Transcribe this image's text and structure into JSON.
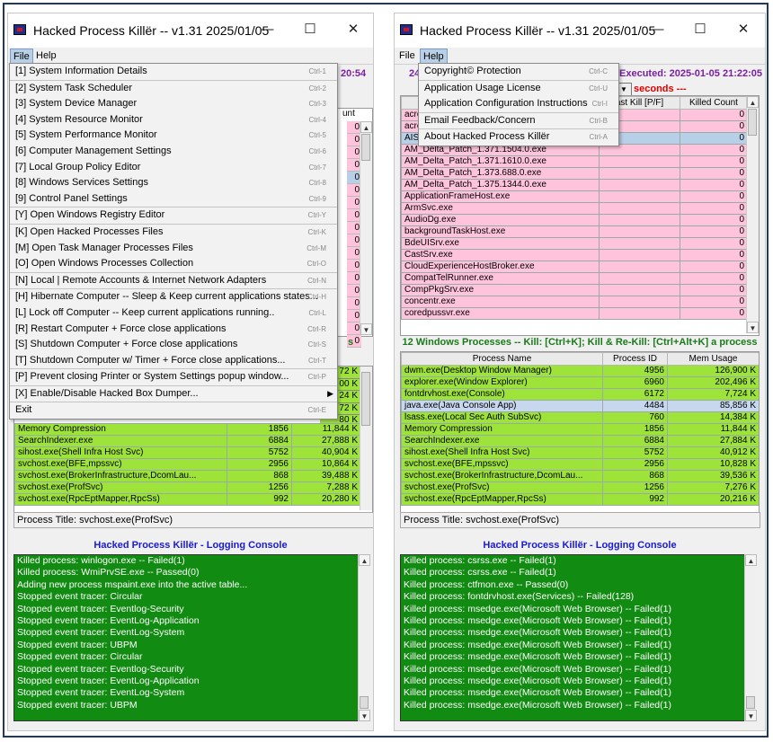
{
  "left": {
    "title": "Hacked Process Killër -- v1.31 2025/01/05",
    "menu_file": "File",
    "menu_help": "Help",
    "subtitle_visible": "20:54",
    "top_columns": [
      "unt"
    ],
    "top_values": [
      "0",
      "0",
      "0",
      "0",
      "0",
      "0",
      "0",
      "0",
      "0",
      "0",
      "0",
      "0",
      "0",
      "0",
      "0",
      "0",
      "0",
      "0"
    ],
    "mid_visible_title": "s",
    "mid_values": [
      "72 K",
      "00 K",
      "24 K",
      "72 K",
      "80 K"
    ],
    "rows": [
      {
        "name": "Memory Compression",
        "pid": "1856",
        "mem": "11,844 K"
      },
      {
        "name": "SearchIndexer.exe",
        "pid": "6884",
        "mem": "27,888 K"
      },
      {
        "name": "sihost.exe(Shell Infra Host Svc)",
        "pid": "5752",
        "mem": "40,904 K"
      },
      {
        "name": "svchost.exe(BFE,mpssvc)",
        "pid": "2956",
        "mem": "10,864 K"
      },
      {
        "name": "svchost.exe(BrokerInfrastructure,DcomLau...",
        "pid": "868",
        "mem": "39,488 K"
      },
      {
        "name": "svchost.exe(ProfSvc)",
        "pid": "1256",
        "mem": "7,288 K"
      },
      {
        "name": "svchost.exe(RpcEptMapper,RpcSs)",
        "pid": "992",
        "mem": "20,280 K"
      }
    ],
    "process_title": "Process Title: svchost.exe(ProfSvc)",
    "console_title": "Hacked Process Killër - Logging Console",
    "console_lines": [
      "Killed process: winlogon.exe -- Failed(1)",
      "Killed process: WmiPrvSE.exe -- Passed(0)",
      "Adding new process mspaint.exe into the active table...",
      "Stopped event tracer: Circular",
      "Stopped event tracer: Eventlog-Security",
      "Stopped event tracer: EventLog-Application",
      "Stopped event tracer: EventLog-System",
      "Stopped event tracer: UBPM",
      "Stopped event tracer: Circular",
      "Stopped event tracer: Eventlog-Security",
      "Stopped event tracer: EventLog-Application",
      "Stopped event tracer: EventLog-System",
      "Stopped event tracer: UBPM"
    ],
    "file_menu": [
      {
        "label": "[1] System Information Details",
        "shortcut": "Ctrl-1",
        "sep": false
      },
      {
        "label": "[2] System Task Scheduler",
        "shortcut": "Ctrl-2",
        "sep": true
      },
      {
        "label": "[3] System Device Manager",
        "shortcut": "Ctrl-3",
        "sep": false
      },
      {
        "label": "[4] System Resource Monitor",
        "shortcut": "Ctrl-4",
        "sep": false
      },
      {
        "label": "[5] System Performance Monitor",
        "shortcut": "Ctrl-5",
        "sep": false
      },
      {
        "label": "[6] Computer Management Settings",
        "shortcut": "Ctrl-6",
        "sep": false
      },
      {
        "label": "[7] Local Group Policy Editor",
        "shortcut": "Ctrl-7",
        "sep": false
      },
      {
        "label": "[8] Windows Services Settings",
        "shortcut": "Ctrl-8",
        "sep": false
      },
      {
        "label": "[9] Control Panel Settings",
        "shortcut": "Ctrl-9",
        "sep": false
      },
      {
        "label": "[Y] Open Windows Registry Editor",
        "shortcut": "Ctrl-Y",
        "sep": true
      },
      {
        "label": "[K] Open Hacked Processes Files",
        "shortcut": "Ctrl-K",
        "sep": true
      },
      {
        "label": "[M] Open Task Manager Processes Files",
        "shortcut": "Ctrl-M",
        "sep": false
      },
      {
        "label": "[O] Open Windows Processes Collection",
        "shortcut": "Ctrl-O",
        "sep": false
      },
      {
        "label": "[N] Local | Remote Accounts & Internet Network Adapters",
        "shortcut": "Ctrl-N",
        "sep": true
      },
      {
        "label": "[H] Hibernate Computer -- Sleep & Keep current applications states...",
        "shortcut": "Ctrl-H",
        "sep": true
      },
      {
        "label": "[L] Lock off Computer -- Keep current applications running..",
        "shortcut": "Ctrl-L",
        "sep": false
      },
      {
        "label": "[R] Restart Computer + Force close applications",
        "shortcut": "Ctrl-R",
        "sep": false
      },
      {
        "label": "[S] Shutdown Computer + Force close applications",
        "shortcut": "Ctrl-S",
        "sep": false
      },
      {
        "label": "[T] Shutdown Computer w/ Timer + Force close applications...",
        "shortcut": "Ctrl-T",
        "sep": false
      },
      {
        "label": "[P] Prevent closing Printer or System Settings popup window...",
        "shortcut": "Ctrl-P",
        "sep": true
      },
      {
        "label": "[X] Enable/Disable Hacked Box Dumper...",
        "shortcut": "",
        "sep": true,
        "submenu": true
      },
      {
        "label": "Exit",
        "shortcut": "Ctrl-E",
        "sep": true
      }
    ]
  },
  "right": {
    "title": "Hacked Process Killër -- v1.31 2025/01/05",
    "menu_file": "File",
    "menu_help": "Help",
    "subtitle_left": "24",
    "subtitle_right": "Executed: 2025-01-05 21:22:05",
    "seconds_label": "seconds ---",
    "top_columns": [
      "ast Kill [P/F]",
      "Killed Count"
    ],
    "top_rows": [
      {
        "name": "acro",
        "count": "0"
      },
      {
        "name": "acro",
        "count": "0"
      },
      {
        "name": "AISt",
        "count": "0"
      },
      {
        "name": "AM_Delta_Patch_1.371.1504.0.exe",
        "count": "0"
      },
      {
        "name": "AM_Delta_Patch_1.371.1610.0.exe",
        "count": "0"
      },
      {
        "name": "AM_Delta_Patch_1.373.688.0.exe",
        "count": "0"
      },
      {
        "name": "AM_Delta_Patch_1.375.1344.0.exe",
        "count": "0"
      },
      {
        "name": "ApplicationFrameHost.exe",
        "count": "0"
      },
      {
        "name": "ArmSvc.exe",
        "count": "0"
      },
      {
        "name": "AudioDg.exe",
        "count": "0"
      },
      {
        "name": "backgroundTaskHost.exe",
        "count": "0"
      },
      {
        "name": "BdeUISrv.exe",
        "count": "0"
      },
      {
        "name": "CastSrv.exe",
        "count": "0"
      },
      {
        "name": "CloudExperienceHostBroker.exe",
        "count": "0"
      },
      {
        "name": "CompatTelRunner.exe",
        "count": "0"
      },
      {
        "name": "CompPkgSrv.exe",
        "count": "0"
      },
      {
        "name": "concentr.exe",
        "count": "0"
      },
      {
        "name": "coredpussvr.exe",
        "count": "0"
      }
    ],
    "mid_title": "12 Windows Processes -- Kill: [Ctrl+K]; Kill & Re-Kill: [Ctrl+Alt+K] a process",
    "mid_columns": [
      "Process Name",
      "Process ID",
      "Mem Usage"
    ],
    "mid_rows": [
      {
        "name": "dwm.exe(Desktop Window Manager)",
        "pid": "4956",
        "mem": "126,900 K"
      },
      {
        "name": "explorer.exe(Window Explorer)",
        "pid": "6960",
        "mem": "202,496 K"
      },
      {
        "name": "fontdrvhost.exe(Console)",
        "pid": "6172",
        "mem": "7,724 K"
      },
      {
        "name": "java.exe(Java Console App)",
        "pid": "4484",
        "mem": "85,856 K"
      },
      {
        "name": "lsass.exe(Local Sec Auth SubSvc)",
        "pid": "760",
        "mem": "14,384 K"
      },
      {
        "name": "Memory Compression",
        "pid": "1856",
        "mem": "11,844 K"
      },
      {
        "name": "SearchIndexer.exe",
        "pid": "6884",
        "mem": "27,884 K"
      },
      {
        "name": "sihost.exe(Shell Infra Host Svc)",
        "pid": "5752",
        "mem": "40,912 K"
      },
      {
        "name": "svchost.exe(BFE,mpssvc)",
        "pid": "2956",
        "mem": "10,828 K"
      },
      {
        "name": "svchost.exe(BrokerInfrastructure,DcomLau...",
        "pid": "868",
        "mem": "39,536 K"
      },
      {
        "name": "svchost.exe(ProfSvc)",
        "pid": "1256",
        "mem": "7,276 K"
      },
      {
        "name": "svchost.exe(RpcEptMapper,RpcSs)",
        "pid": "992",
        "mem": "20,216 K"
      }
    ],
    "process_title": "Process Title: svchost.exe(ProfSvc)",
    "console_title": "Hacked Process Killër - Logging Console",
    "console_lines": [
      "Killed process: csrss.exe -- Failed(1)",
      "Killed process: csrss.exe -- Failed(1)",
      "Killed process: ctfmon.exe -- Passed(0)",
      "Killed process: fontdrvhost.exe(Services) -- Failed(128)",
      "Killed process: msedge.exe(Microsoft Web Browser) -- Failed(1)",
      "Killed process: msedge.exe(Microsoft Web Browser) -- Failed(1)",
      "Killed process: msedge.exe(Microsoft Web Browser) -- Failed(1)",
      "Killed process: msedge.exe(Microsoft Web Browser) -- Failed(1)",
      "Killed process: msedge.exe(Microsoft Web Browser) -- Failed(1)",
      "Killed process: msedge.exe(Microsoft Web Browser) -- Failed(1)",
      "Killed process: msedge.exe(Microsoft Web Browser) -- Failed(1)",
      "Killed process: msedge.exe(Microsoft Web Browser) -- Failed(1)",
      "Killed process: msedge.exe(Microsoft Web Browser) -- Failed(1)"
    ],
    "help_menu": [
      {
        "label": "Copyright© Protection",
        "shortcut": "Ctrl-C",
        "sep": false
      },
      {
        "label": "Application Usage License",
        "shortcut": "Ctrl-U",
        "sep": true
      },
      {
        "label": "Application Configuration Instructions",
        "shortcut": "Ctrl-I",
        "sep": false
      },
      {
        "label": "Email Feedback/Concern",
        "shortcut": "Ctrl-B",
        "sep": true
      },
      {
        "label": "About Hacked Process Killër",
        "shortcut": "Ctrl-A",
        "sep": true
      }
    ]
  },
  "icons": {
    "minimize": "minimize-icon",
    "maximize": "maximize-icon",
    "close": "close-icon",
    "app": "app-icon"
  },
  "colors": {
    "pink_row": "#ffc4dc",
    "green_row": "#9ee33a",
    "console_bg": "#118b11",
    "selected": "#b8cfe8"
  }
}
